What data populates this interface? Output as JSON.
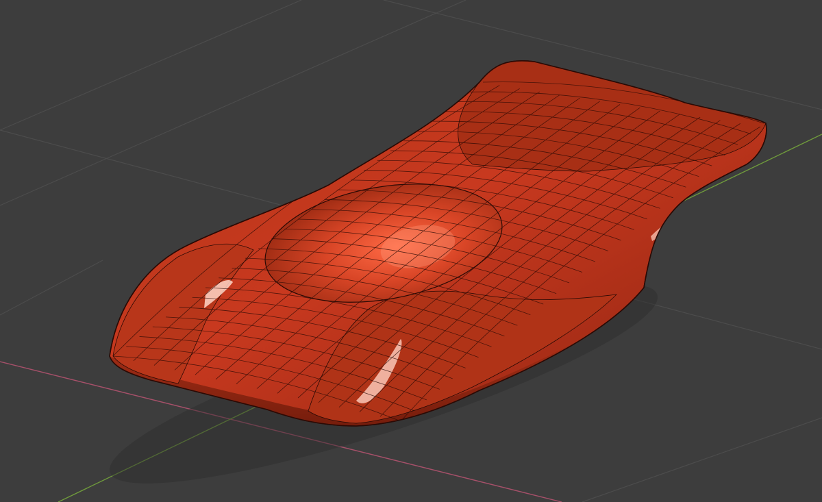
{
  "viewport": {
    "background_color": "#3d3d3d",
    "grid_line_color": "#4c4c4c",
    "x_axis_color": "#a7506a",
    "y_axis_color": "#6f9a3c"
  },
  "model": {
    "body_color": "#c8391f",
    "shadow_color": "#5a1408",
    "highlight_color": "#ff8f70",
    "wireframe_color": "#2a0a05"
  }
}
